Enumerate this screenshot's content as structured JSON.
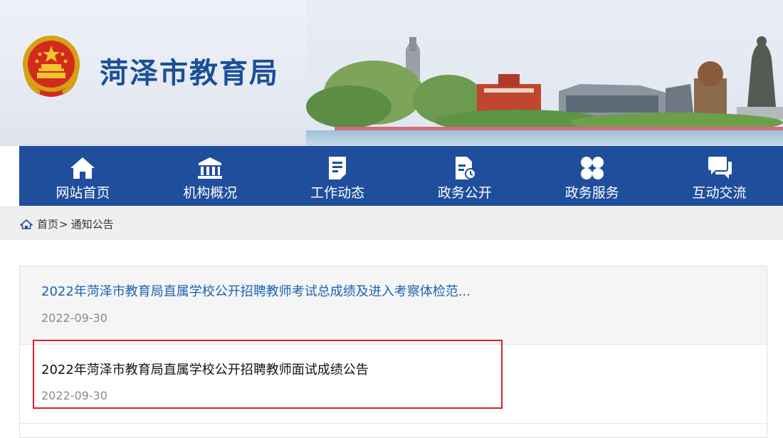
{
  "site": {
    "title": "菏泽市教育局"
  },
  "nav": {
    "items": [
      {
        "label": "网站首页",
        "icon": "home-icon"
      },
      {
        "label": "机构概况",
        "icon": "institution-icon"
      },
      {
        "label": "工作动态",
        "icon": "document-icon"
      },
      {
        "label": "政务公开",
        "icon": "file-open-icon"
      },
      {
        "label": "政务服务",
        "icon": "grid-icon"
      },
      {
        "label": "互动交流",
        "icon": "chat-icon"
      }
    ]
  },
  "breadcrumb": {
    "home": "首页",
    "separator": ">",
    "current": "通知公告"
  },
  "notices": [
    {
      "title": "2022年菏泽市教育局直属学校公开招聘教师考试总成绩及进入考察体检范...",
      "date": "2022-09-30"
    },
    {
      "title": "2022年菏泽市教育局直属学校公开招聘教师面试成绩公告",
      "date": "2022-09-30"
    }
  ],
  "colors": {
    "nav_bg": "#1f4f9c",
    "title_blue": "#1c4f97",
    "link_blue": "#1a62b5",
    "highlight_red": "#d9202a"
  }
}
